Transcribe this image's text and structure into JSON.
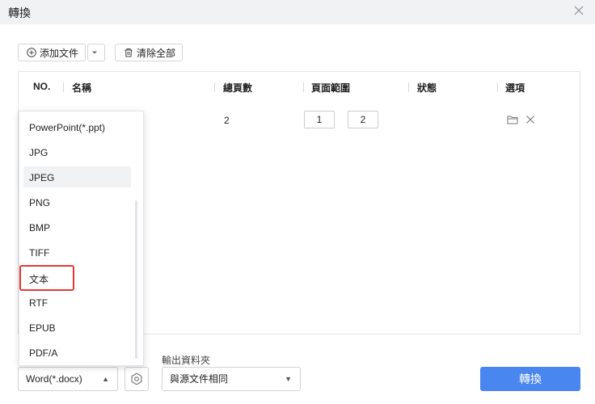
{
  "window": {
    "title": "轉換",
    "close_icon": "close-icon"
  },
  "toolbar": {
    "add_file_label": "添加文件",
    "clear_all_label": "清除全部"
  },
  "table": {
    "headers": {
      "no": "NO.",
      "name": "名稱",
      "total_pages": "總頁數",
      "page_range": "頁面範圍",
      "status": "狀態",
      "options": "選項"
    },
    "rows": [
      {
        "total_pages": "2",
        "range_from": "1",
        "range_to": "2"
      }
    ]
  },
  "format_dropdown": {
    "options": [
      "PowerPoint(*.ppt)",
      "JPG",
      "JPEG",
      "PNG",
      "BMP",
      "TIFF",
      "文本",
      "RTF",
      "EPUB",
      "PDF/A"
    ],
    "hovered_option": "JPEG",
    "highlighted_option": "文本"
  },
  "bottom": {
    "format_selected": "Word(*.docx)",
    "output_folder_label": "輸出資料夾",
    "output_folder_value": "與源文件相同",
    "convert_label": "轉換"
  },
  "colors": {
    "accent": "#4a86f0",
    "highlight": "#e23a36",
    "titlebar": "#f1f2f4"
  }
}
